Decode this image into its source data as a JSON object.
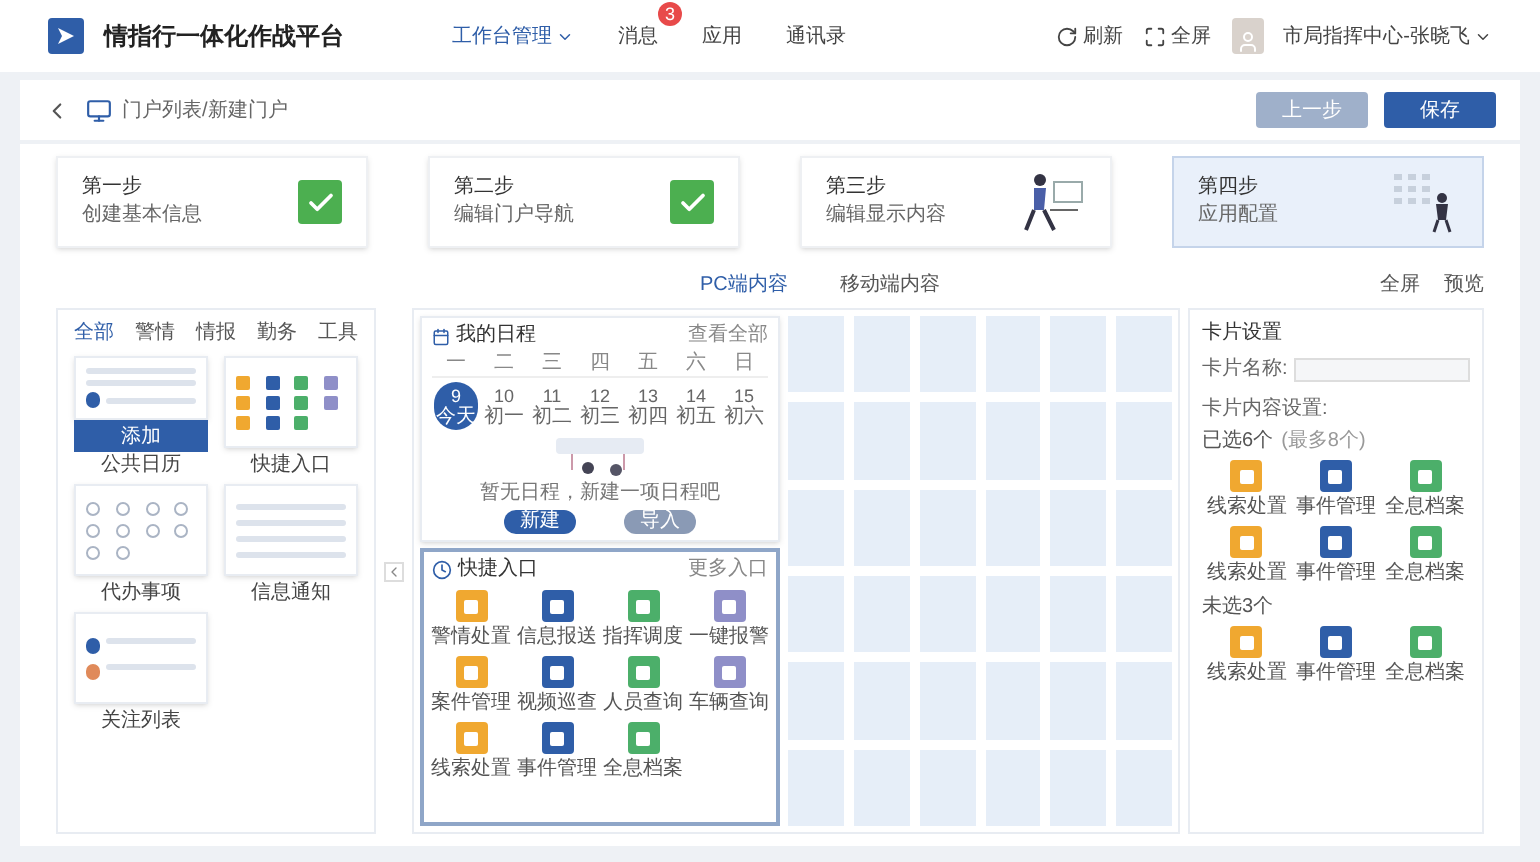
{
  "header": {
    "title": "情指行一体化作战平台",
    "nav": [
      {
        "label": "工作台管理",
        "selected": true,
        "dropdown": true
      },
      {
        "label": "消息",
        "selected": false,
        "dropdown": false,
        "badge": "3"
      },
      {
        "label": "应用",
        "selected": false,
        "dropdown": false
      },
      {
        "label": "通讯录",
        "selected": false,
        "dropdown": false
      }
    ],
    "actions": [
      {
        "kind": "refresh",
        "label": "刷新"
      },
      {
        "kind": "fullscreen",
        "label": "全屏"
      }
    ],
    "user": "市局指挥中心-张晓飞"
  },
  "breadcrumb": "门户列表/新建门户",
  "buttons": [
    {
      "label": "上一步",
      "disabled": true
    },
    {
      "label": "保存",
      "disabled": false
    }
  ],
  "steps": [
    {
      "step": "第一步",
      "title": "创建基本信息",
      "kind": "done",
      "selected": false
    },
    {
      "step": "第二步",
      "title": "编辑门户导航",
      "kind": "done",
      "selected": false
    },
    {
      "step": "第三步",
      "title": "编辑显示内容",
      "kind": "desk",
      "selected": false
    },
    {
      "step": "第四步",
      "title": "应用配置",
      "kind": "board",
      "selected": true
    }
  ],
  "content_tabs": [
    {
      "label": "PC端内容",
      "selected": true
    },
    {
      "label": "移动端内容",
      "selected": false
    }
  ],
  "view_actions": [
    "全屏",
    "预览"
  ],
  "library": {
    "tabs": [
      {
        "label": "全部",
        "selected": true
      },
      {
        "label": "警情",
        "selected": false
      },
      {
        "label": "情报",
        "selected": false
      },
      {
        "label": "勤务",
        "selected": false
      },
      {
        "label": "工具",
        "selected": false
      }
    ],
    "add_button": "添加",
    "widgets": [
      {
        "label": "公共日历",
        "kind": "calendar",
        "hovered": true
      },
      {
        "label": "快捷入口",
        "kind": "entries",
        "hovered": false
      },
      {
        "label": "代办事项",
        "kind": "todo",
        "hovered": false
      },
      {
        "label": "信息通知",
        "kind": "list",
        "hovered": false
      },
      {
        "label": "关注列表",
        "kind": "follow",
        "hovered": false
      }
    ]
  },
  "calendar": {
    "title": "我的日程",
    "link": "查看全部",
    "weekdays": [
      "一",
      "二",
      "三",
      "四",
      "五",
      "六",
      "日"
    ],
    "days": [
      {
        "day": "9",
        "sub": "今天",
        "selected": true
      },
      {
        "day": "10",
        "sub": "初一",
        "selected": false
      },
      {
        "day": "11",
        "sub": "初二",
        "selected": false
      },
      {
        "day": "12",
        "sub": "初三",
        "selected": false
      },
      {
        "day": "13",
        "sub": "初四",
        "selected": false
      },
      {
        "day": "14",
        "sub": "初五",
        "selected": false
      },
      {
        "day": "15",
        "sub": "初六",
        "selected": false
      }
    ],
    "caption": "暂无日程，新建一项日程吧",
    "primary": "新建",
    "secondary": "导入"
  },
  "quick_entry": {
    "title": "快捷入口",
    "link": "更多入口",
    "selected": true,
    "items": [
      {
        "label": "警情处置",
        "color": "#f0a830"
      },
      {
        "label": "信息报送",
        "color": "#2f5ea8"
      },
      {
        "label": "指挥调度",
        "color": "#4caf6a"
      },
      {
        "label": "一键报警",
        "color": "#8f8fc8"
      },
      {
        "label": "案件管理",
        "color": "#f0a830"
      },
      {
        "label": "视频巡查",
        "color": "#2f5ea8"
      },
      {
        "label": "人员查询",
        "color": "#4caf6a"
      },
      {
        "label": "车辆查询",
        "color": "#8f8fc8"
      },
      {
        "label": "线索处置",
        "color": "#f0a830"
      },
      {
        "label": "事件管理",
        "color": "#2f5ea8"
      },
      {
        "label": "全息档案",
        "color": "#4caf6a"
      }
    ]
  },
  "settings": {
    "title": "卡片设置",
    "name_label": "卡片名称:",
    "content_label": "卡片内容设置:",
    "selected_label": "已选6个",
    "selected_hint": "(最多8个)",
    "selected_items": [
      {
        "label": "线索处置",
        "color": "#f0a830"
      },
      {
        "label": "事件管理",
        "color": "#2f5ea8"
      },
      {
        "label": "全息档案",
        "color": "#4caf6a"
      },
      {
        "label": "线索处置",
        "color": "#f0a830"
      },
      {
        "label": "事件管理",
        "color": "#2f5ea8"
      },
      {
        "label": "全息档案",
        "color": "#4caf6a"
      }
    ],
    "unselected_label": "未选3个",
    "unselected_items": [
      {
        "label": "线索处置",
        "color": "#f0a830"
      },
      {
        "label": "事件管理",
        "color": "#2f5ea8"
      },
      {
        "label": "全息档案",
        "color": "#4caf6a"
      }
    ]
  }
}
